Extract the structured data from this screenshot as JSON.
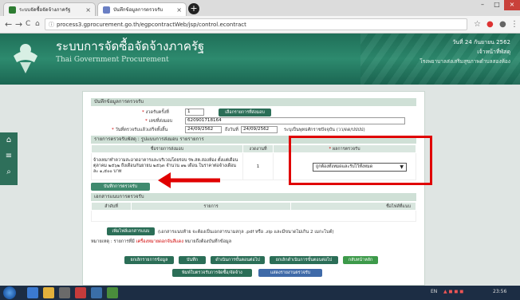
{
  "browser": {
    "tabs": [
      {
        "title": "ระบบจัดซื้อจัดจ้างภาครัฐ",
        "color": "#2e7d32"
      },
      {
        "title": "บันทึกข้อมูลการตรวจรับ",
        "color": "#6a7fc4"
      }
    ],
    "url": "process3.gprocurement.go.th/egpcontractWeb/jsp/control.econtract",
    "nav": {
      "back": "←",
      "forward": "→",
      "reload": "C",
      "home": "⌂"
    }
  },
  "header": {
    "title": "ระบบการจัดซื้อจัดจ้างภาครัฐ",
    "subtitle": "Thai Government Procurement",
    "date": "วันที่ 24 กันยายน 2562",
    "role": "เจ้าหน้าที่พัสดุ",
    "org": "โรงพยาบาลส่งเสริมสุขภาพตำบลสองห้อง"
  },
  "dock": {
    "icons": [
      "home-icon",
      "menu-icon",
      "search-icon"
    ]
  },
  "form": {
    "section_title": "บันทึกข้อมูลการตรวจรับ",
    "fields": {
      "round_label": "งวดรับครั้งที่",
      "round_value": "1",
      "round_button": "เลือกรายการที่ส่งมอบ",
      "delivery_no_label": "เลขที่ส่งมอบ",
      "delivery_no_value": "620901718164",
      "inspect_date_label": "วันที่ตรวจรับแล้วเสร็จทั้งสิ้น",
      "inspect_date_value": "24/09/2562",
      "to_label": "ถึงวันที่",
      "to_value": "24/09/2562",
      "calendar_note": "ระบุเป็นพุทธศักราชปัจจุบัน (วว/ดด/ปปปป)"
    }
  },
  "inspection": {
    "section_title": "รายการตรวจรับพัสดุ : รูปแบบการส่งมอบ รายรายการ",
    "columns": [
      "ชื่อรายการส่งมอบ",
      "งวดงานที่",
      "ผลการตรวจรับ"
    ],
    "rows": [
      {
        "name": "จ้างเหมาทำความสะอาดอาคารและบริเวณโดยรอบ รพ.สต.สองห้อง ตั้งแต่เดือนตุลาคม ๒๕๖๒ ถึงเดือนกันยายน ๒๕๖๓ จำนวน ๑๒ เดือน ในราคาต่อจ้างเดือนละ ๑,๕๐๐ บาท",
        "period": "1",
        "result": "ถูกต้องทั้งหมดและรับไว้ทั้งหมด"
      }
    ],
    "save_button": "บันทึกการตรวจรับ"
  },
  "attachments": {
    "section_title": "เอกสารแนบการตรวจรับ",
    "columns": [
      "ลำดับที่",
      "รายการ",
      "ชื่อไฟล์ที่แนบ"
    ],
    "upload_button": "เพิ่มไฟล์เอกสารแนบ",
    "upload_note": "(เอกสารแนบท้าย จะต้องเป็นเอกสารนามสกุล .pdf หรือ .zip และมีขนาดไม่เกิน 2 เมกะไบต์)",
    "remark_prefix": "หมายเหตุ : รายการที่มี",
    "remark_highlight": "เครื่องหมายดอกจันสีแดง",
    "remark_suffix": "หมายถึงต้องบันทึกข้อมูล"
  },
  "actions": {
    "row1": [
      "ยกเลิกรายการข้อมูล",
      "บันทึก",
      "ดำเนินการขั้นตอนต่อไป",
      "ยกเลิกดำเนินการขั้นตอนต่อไป",
      "กลับหน้าหลัก"
    ],
    "row2": [
      "พิมพ์ใบตรวจรับการจัดซื้อ/จัดจ้าง",
      "แสดงรายงานตรวจรับ"
    ]
  },
  "taskbar": {
    "lang": "EN",
    "time": "23:56"
  },
  "colors": {
    "brand_green": "#2b6e57",
    "highlight_red": "#e00000"
  }
}
